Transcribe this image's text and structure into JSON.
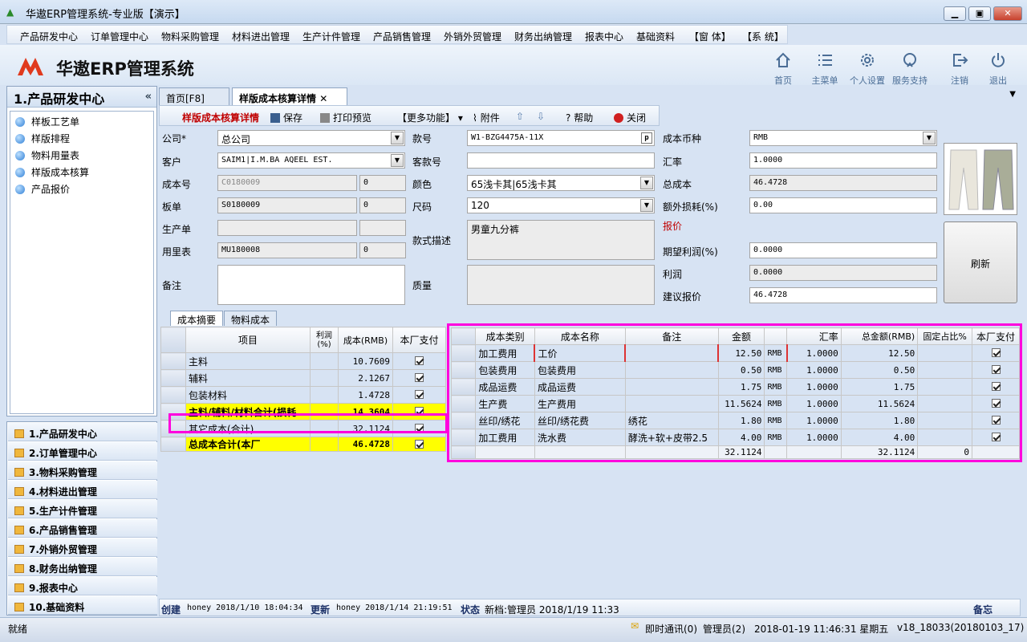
{
  "window": {
    "title": "华遨ERP管理系统-专业版【演示】"
  },
  "menu": [
    "产品研发中心",
    "订单管理中心",
    "物料采购管理",
    "材料进出管理",
    "生产计件管理",
    "产品销售管理",
    "外销外贸管理",
    "财务出纳管理",
    "报表中心",
    "基础资料",
    "【窗 体】",
    "【系 统】"
  ],
  "header": {
    "brand": "华遨ERP管理系统",
    "icons": [
      {
        "label": "首页",
        "icon": "home-icon"
      },
      {
        "label": "主菜单",
        "icon": "list-icon"
      },
      {
        "label": "个人设置",
        "icon": "gear-icon"
      },
      {
        "label": "服务支持",
        "icon": "support-icon"
      },
      {
        "label": "注销",
        "icon": "logout-icon"
      },
      {
        "label": "退出",
        "icon": "power-icon"
      }
    ]
  },
  "left": {
    "title": "1.产品研发中心",
    "collapse": "«",
    "items": [
      "样板工艺单",
      "样版排程",
      "物料用量表",
      "样版成本核算",
      "产品报价"
    ]
  },
  "modules": [
    "1.产品研发中心",
    "2.订单管理中心",
    "3.物料采购管理",
    "4.材料进出管理",
    "5.生产计件管理",
    "6.产品销售管理",
    "7.外销外贸管理",
    "8.财务出纳管理",
    "9.报表中心",
    "10.基础资料"
  ],
  "tabs": [
    {
      "label": "首页[F8]"
    },
    {
      "label": "样版成本核算详情"
    }
  ],
  "toolbar": {
    "title": "样版成本核算详情",
    "save": "保存",
    "print": "打印预览",
    "more": "【更多功能】",
    "attach": "附件",
    "help": "帮助",
    "close": "关闭"
  },
  "form": {
    "company_label": "公司*",
    "company": "总公司",
    "customer_label": "客户",
    "customer": "SAIM1|I.M.BA AQEEL EST.",
    "costno_label": "成本号",
    "costno": "C0180009",
    "costno_n": "0",
    "board_label": "板单",
    "board": "S0180009",
    "board_n": "0",
    "prod_label": "生产单",
    "prod": "",
    "prod_n": "",
    "usage_label": "用里表",
    "usage": "MU180008",
    "usage_n": "0",
    "remark_label": "备注",
    "remark": "",
    "style_label": "款号",
    "style": "W1-BZG4475A-11X",
    "cstyle_label": "客款号",
    "cstyle": "",
    "color_label": "颜色",
    "color": "65浅卡其|65浅卡其",
    "size_label": "尺码",
    "size": "120",
    "desc_label": "款式描述",
    "desc": "男童九分裤",
    "quality_label": "质量",
    "quality": "",
    "currency_label": "成本币种",
    "currency": "RMB",
    "rate_label": "汇率",
    "rate": "1.0000",
    "total_label": "总成本",
    "total": "46.4728",
    "extra_label": "额外损耗(%)",
    "extra": "0.00",
    "quote_label": "报价",
    "profit_pct_label": "期望利润(%)",
    "profit_pct": "0.0000",
    "profit_label": "利润",
    "profit": "0.0000",
    "suggest_label": "建议报价",
    "suggest": "46.4728",
    "refresh": "刷新"
  },
  "subtabs": [
    "成本摘要",
    "物料成本"
  ],
  "summary": {
    "headers": [
      "项目",
      "利润(%)",
      "成本(RMB)",
      "本厂支付"
    ],
    "rows": [
      {
        "item": "主料",
        "profit": "",
        "cost": "10.7609",
        "pay": true
      },
      {
        "item": "辅料",
        "profit": "",
        "cost": "2.1267",
        "pay": true
      },
      {
        "item": "包装材料",
        "profit": "",
        "cost": "1.4728",
        "pay": true
      },
      {
        "item": "主料/辅料/材料合计(损耗",
        "profit": "",
        "cost": "14.3604",
        "pay": true,
        "yellow": true
      },
      {
        "item": "其它成本(合计)",
        "profit": "",
        "cost": "32.1124",
        "pay": true
      },
      {
        "item": "总成本合计(本厂",
        "profit": "",
        "cost": "46.4728",
        "pay": true,
        "yellow": true
      }
    ]
  },
  "detail": {
    "headers": [
      "成本类别",
      "成本名称",
      "备注",
      "金额",
      "",
      "汇率",
      "总金额(RMB)",
      "固定占比%",
      "本厂支付"
    ],
    "rows": [
      {
        "cat": "加工费用",
        "name": "工价",
        "remark": "",
        "amount": "12.50",
        "cur": "RMB",
        "rate": "1.0000",
        "total": "12.50",
        "pct": "",
        "pay": true
      },
      {
        "cat": "包装费用",
        "name": "包装费用",
        "remark": "",
        "amount": "0.50",
        "cur": "RMB",
        "rate": "1.0000",
        "total": "0.50",
        "pct": "",
        "pay": true
      },
      {
        "cat": "成品运费",
        "name": "成品运费",
        "remark": "",
        "amount": "1.75",
        "cur": "RMB",
        "rate": "1.0000",
        "total": "1.75",
        "pct": "",
        "pay": true
      },
      {
        "cat": "生产费",
        "name": "生产费用",
        "remark": "",
        "amount": "11.5624",
        "cur": "RMB",
        "rate": "1.0000",
        "total": "11.5624",
        "pct": "",
        "pay": true
      },
      {
        "cat": "丝印/绣花",
        "name": "丝印/绣花费",
        "remark": "绣花",
        "amount": "1.80",
        "cur": "RMB",
        "rate": "1.0000",
        "total": "1.80",
        "pct": "",
        "pay": true
      },
      {
        "cat": "加工费用",
        "name": "洗水费",
        "remark": "酵洗+软+皮带2.5",
        "amount": "4.00",
        "cur": "RMB",
        "rate": "1.0000",
        "total": "4.00",
        "pct": "",
        "pay": true
      }
    ],
    "footer": {
      "amount": "32.1124",
      "total": "32.1124",
      "pct": "0"
    }
  },
  "info": {
    "created_label": "创建",
    "created": "honey 2018/1/10 18:04:34",
    "updated_label": "更新",
    "updated": "honey 2018/1/14 21:19:51",
    "state_label": "状态",
    "state": "新档:管理员 2018/1/19 11:33",
    "memo": "备忘"
  },
  "status": {
    "ready": "就绪",
    "im": "即时通讯(0)",
    "user": "管理员(2)",
    "datetime": "2018-01-19  11:46:31 星期五",
    "version": "v18_18033(20180103_17)"
  },
  "colors": {
    "highlight": "#ff00dd",
    "yellow": "#ffff00",
    "accent_red": "#c00000"
  }
}
